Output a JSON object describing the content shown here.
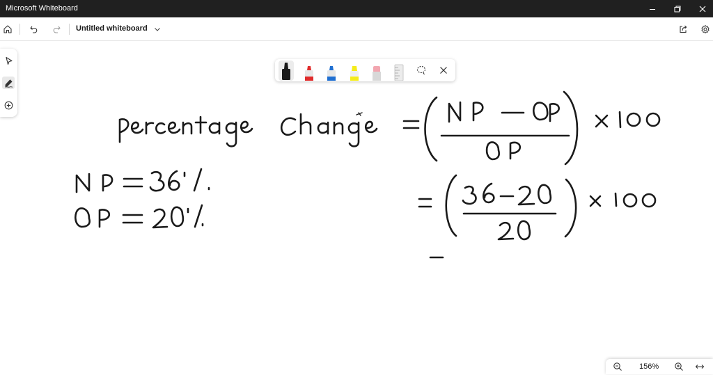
{
  "window": {
    "title": "Microsoft Whiteboard",
    "controls": [
      "minimize-icon",
      "restore-icon",
      "close-icon"
    ]
  },
  "toolbar": {
    "board_title": "Untitled whiteboard",
    "icons": [
      "home-icon",
      "undo-icon",
      "redo-icon",
      "chevron-down-icon",
      "share-icon",
      "settings-icon"
    ]
  },
  "left_rail": {
    "tools": [
      "select-icon",
      "ink-icon",
      "add-icon"
    ],
    "active": "ink-icon"
  },
  "ink_toolbar": {
    "pens": [
      {
        "name": "black-pen",
        "color": "#1a1a1a"
      },
      {
        "name": "red-pen",
        "color": "#e02b2b"
      },
      {
        "name": "blue-pen",
        "color": "#1f6fd1"
      },
      {
        "name": "yellow-highlighter",
        "color": "#f5ec1a"
      },
      {
        "name": "eraser",
        "color": "#f2a6b0"
      },
      {
        "name": "ruler",
        "color": "#bdbdbd"
      }
    ],
    "active_pen": "black-pen",
    "icons": [
      "lasso-icon",
      "close-icon"
    ]
  },
  "canvas": {
    "handwriting": [
      "Percentage Change = ( (NP - OP) / OP ) x 100",
      "NP = 36%",
      "OP = 20%",
      "= ( (36-20) / 20 ) x 100",
      "-"
    ],
    "ink_color": "#1a1a1a"
  },
  "zoom": {
    "level": "156%",
    "icons": [
      "zoom-out-icon",
      "zoom-in-icon",
      "fit-to-screen-icon"
    ]
  }
}
